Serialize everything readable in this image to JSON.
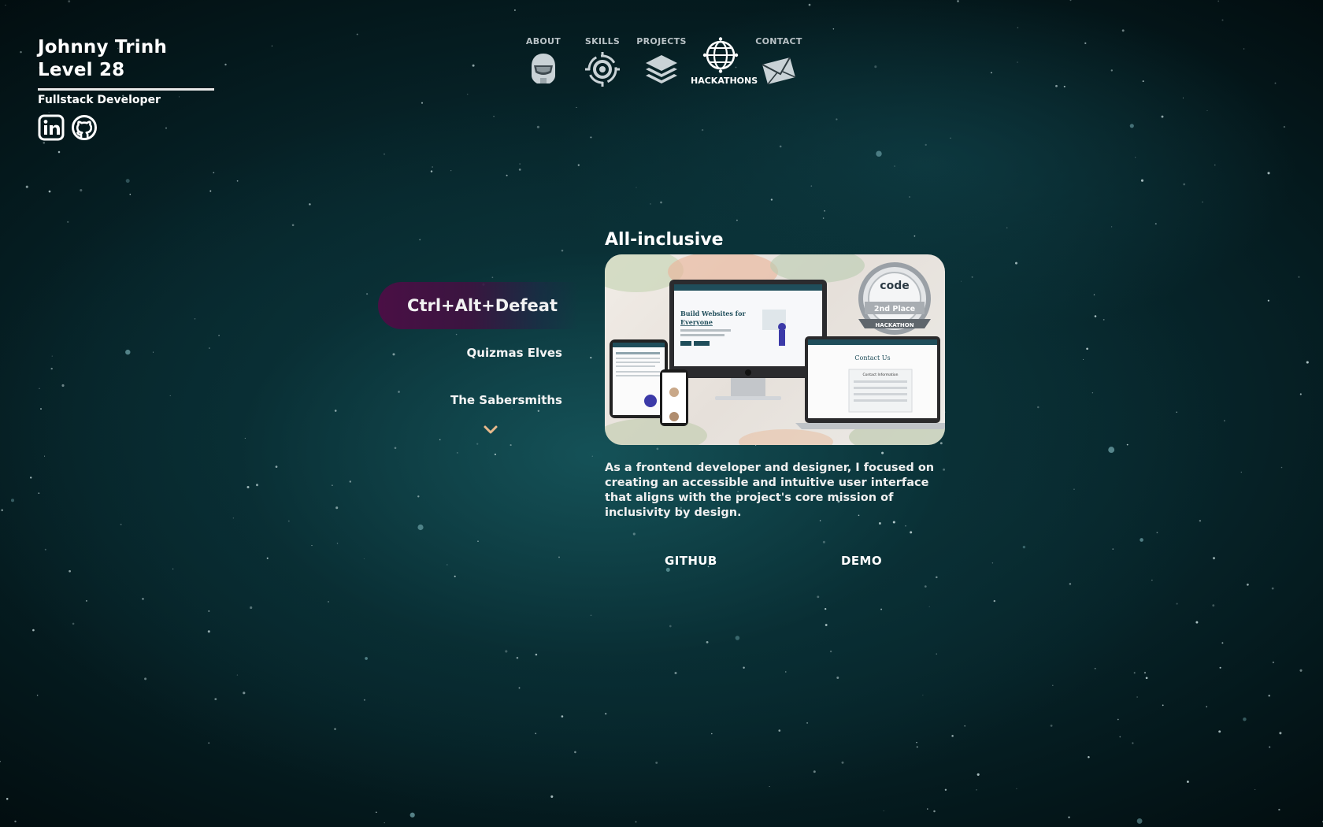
{
  "profile": {
    "name": "Johnny Trinh",
    "level": "Level 28",
    "role": "Fullstack Developer",
    "socials": [
      {
        "name": "linkedin",
        "icon": "linkedin-icon"
      },
      {
        "name": "github",
        "icon": "github-icon"
      }
    ]
  },
  "nav": {
    "items": [
      {
        "label": "ABOUT",
        "icon": "helmet-icon"
      },
      {
        "label": "SKILLS",
        "icon": "target-icon"
      },
      {
        "label": "PROJECTS",
        "icon": "layers-icon"
      },
      {
        "label": "HACKATHONS",
        "icon": "globe-icon",
        "active": true
      },
      {
        "label": "CONTACT",
        "icon": "envelope-icon"
      }
    ]
  },
  "hackathons": {
    "active": "Ctrl+Alt+Defeat",
    "items": [
      "Quizmas Elves",
      "The Sabersmiths"
    ],
    "more_icon": "chevron-down-icon"
  },
  "project": {
    "title": "All-inclusive",
    "image_alt": "All-inclusive website mockups on devices with 2nd Place hackathon badge",
    "badge": {
      "brand": "code",
      "place": "2nd Place",
      "event": "HACKATHON"
    },
    "mockup": {
      "headline": "Build Websites for",
      "headline_em": "Everyone",
      "contact": "Contact Us",
      "contact_sub": "Contact Information"
    },
    "description": "As a frontend developer and designer, I focused on creating an accessible and intuitive user interface that aligns with the project's core mission of inclusivity by design.",
    "links": {
      "github": "GITHUB",
      "demo": "DEMO"
    }
  },
  "colors": {
    "background": "#0a2e33",
    "active_pill": "#4a0f45",
    "text": "#ffffff",
    "nav_muted": "#b9c2c6",
    "chevron": "#e8b98c"
  }
}
